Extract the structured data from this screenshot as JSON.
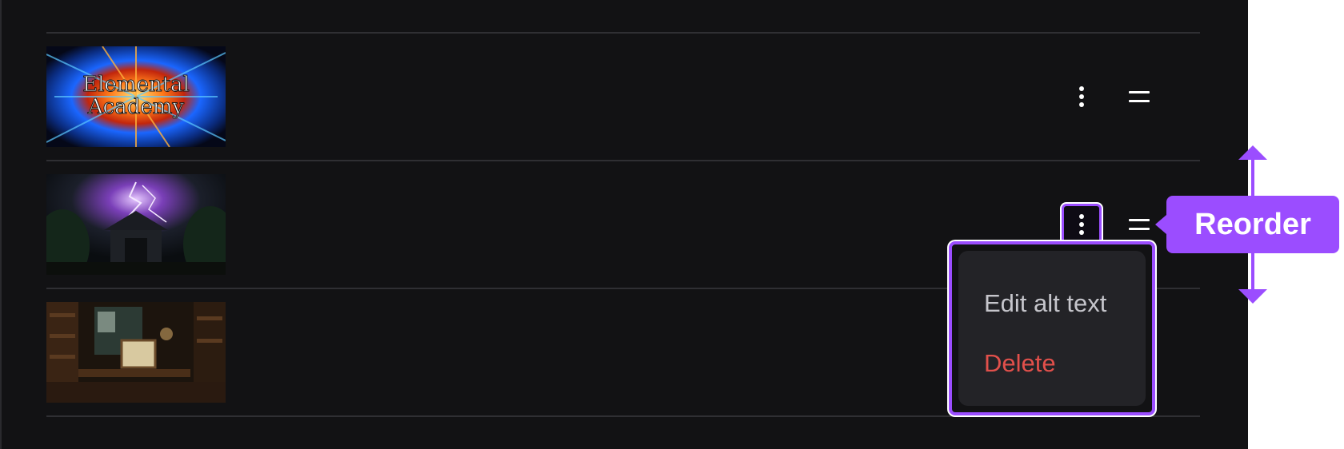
{
  "images": [
    {
      "id": "row-1",
      "logo_line1": "Elemental",
      "logo_line2": "Academy"
    },
    {
      "id": "row-2"
    },
    {
      "id": "row-3"
    }
  ],
  "context_menu": {
    "items": [
      {
        "label": "Edit alt text",
        "color": "#c6c6cc"
      },
      {
        "label": "Delete",
        "color": "#e2504b"
      }
    ]
  },
  "callout": {
    "label": "Reorder"
  },
  "icons": {
    "more": "vertical-ellipsis-icon",
    "drag": "drag-handle-icon",
    "arrow": "up-down-arrow-icon"
  },
  "colors": {
    "background": "#121214",
    "divider": "#2f2f33",
    "accent": "#9b4dff",
    "menu_background": "#232327"
  }
}
